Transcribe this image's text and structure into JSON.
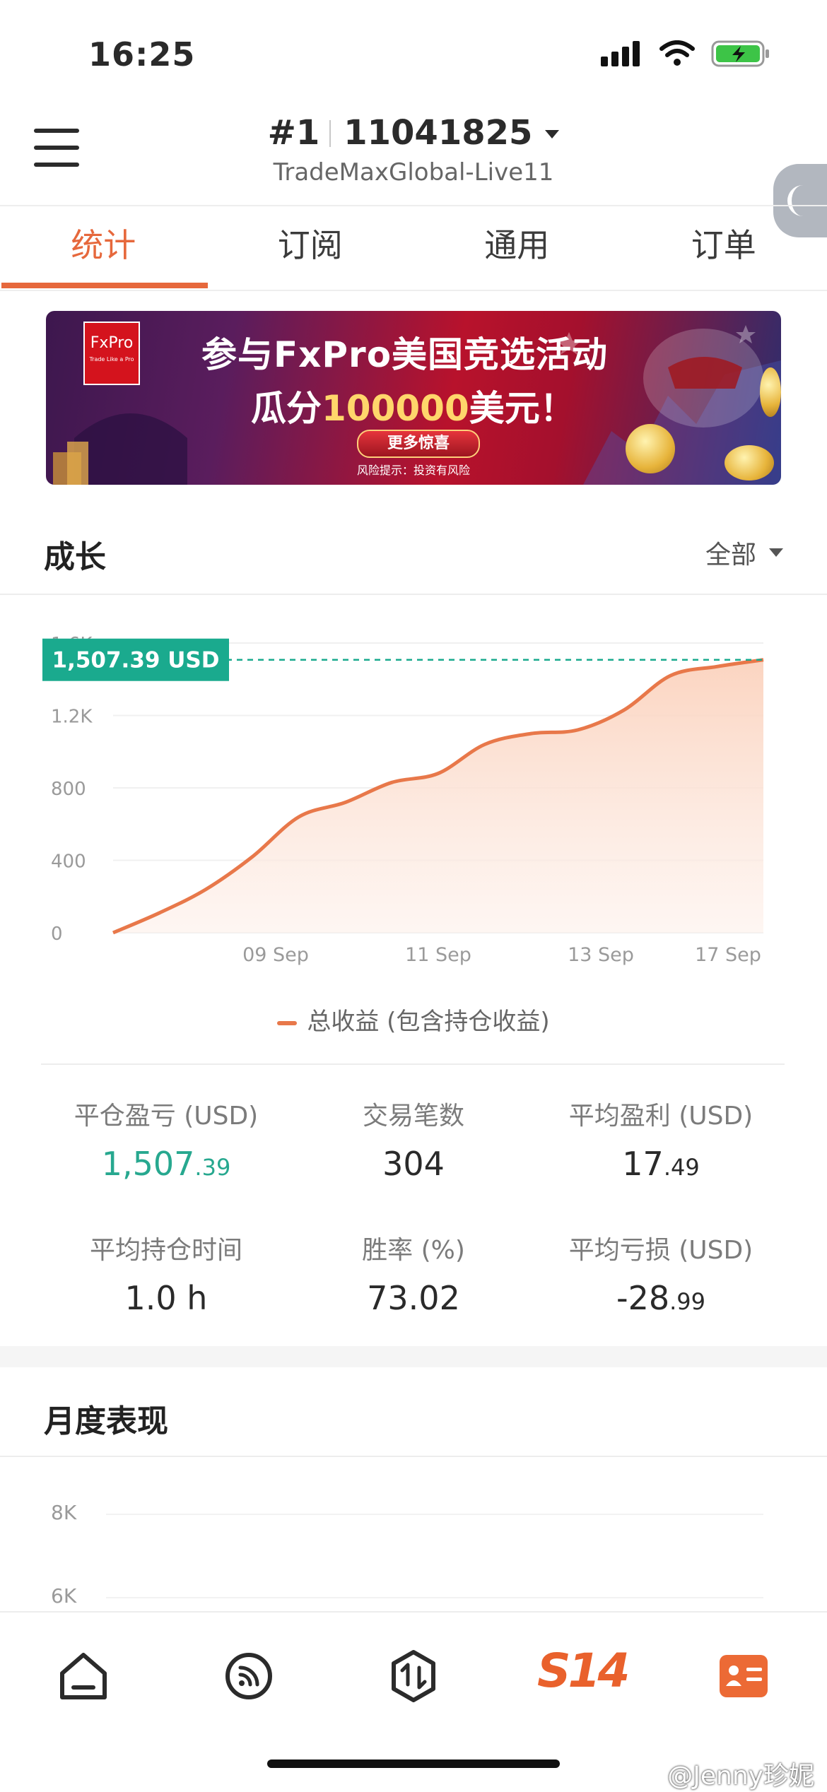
{
  "status_bar": {
    "time": "16:25"
  },
  "header": {
    "account_rank": "#1",
    "account_number": "11041825",
    "server": "TradeMaxGlobal-Live11"
  },
  "tabs": [
    {
      "label": "统计",
      "active": true
    },
    {
      "label": "订阅",
      "active": false
    },
    {
      "label": "通用",
      "active": false
    },
    {
      "label": "订单",
      "active": false
    }
  ],
  "banner": {
    "logo": "FxPro",
    "logo_tagline": "Trade Like a Pro",
    "title": "参与FxPro美国竞选活动",
    "subtitle_prefix": "瓜分",
    "subtitle_amount": "100000",
    "subtitle_suffix": "美元！",
    "cta": "更多惊喜",
    "risk_notice": "风险提示：投资有风险"
  },
  "growth": {
    "title": "成长",
    "filter": "全部",
    "current_value_label": "1,507.39 USD",
    "legend": "总收益 (包含持仓收益)"
  },
  "chart_data": {
    "type": "area",
    "title": "",
    "series": [
      {
        "name": "总收益 (包含持仓收益)",
        "x": [
          "07 Sep",
          "08 Sep",
          "08 Sep",
          "09 Sep",
          "09 Sep",
          "10 Sep",
          "10 Sep",
          "11 Sep",
          "11 Sep",
          "12 Sep",
          "13 Sep",
          "13 Sep",
          "14 Sep",
          "17 Sep",
          "17 Sep"
        ],
        "values": [
          0,
          110,
          240,
          420,
          640,
          720,
          830,
          880,
          1040,
          1100,
          1120,
          1230,
          1420,
          1470,
          1507.39
        ]
      }
    ],
    "x_tick_labels": [
      "09 Sep",
      "11 Sep",
      "13 Sep",
      "17 Sep"
    ],
    "y_tick_labels": [
      "0",
      "400",
      "800",
      "1.2K",
      "1.6K"
    ],
    "ylim": [
      0,
      1600
    ],
    "reference_line": 1507.39,
    "colors": {
      "line": "#e8784a",
      "fill": "#fbd9c8",
      "reference": "#1aaa8e"
    }
  },
  "stats": [
    {
      "label": "平仓盈亏 (USD)",
      "int": "1,507",
      "dec": ".39",
      "highlight": true
    },
    {
      "label": "交易笔数",
      "int": "304",
      "dec": "",
      "highlight": false
    },
    {
      "label": "平均盈利 (USD)",
      "int": "17",
      "dec": ".49",
      "highlight": false
    },
    {
      "label": "平均持仓时间",
      "int": "1.0 h",
      "dec": "",
      "highlight": false
    },
    {
      "label": "胜率 (%)",
      "int": "73.02",
      "dec": "",
      "highlight": false
    },
    {
      "label": "平均亏损 (USD)",
      "int": "-28",
      "dec": ".99",
      "highlight": false
    }
  ],
  "monthly": {
    "title": "月度表现",
    "y_tick_labels": [
      "8K",
      "6K"
    ]
  },
  "bottom_nav": {
    "items": [
      "home-icon",
      "feed-icon",
      "trade-icon",
      "s14-icon",
      "profile-card-icon"
    ],
    "s14_label": "S14"
  },
  "watermark": "@Jenny珍妮"
}
